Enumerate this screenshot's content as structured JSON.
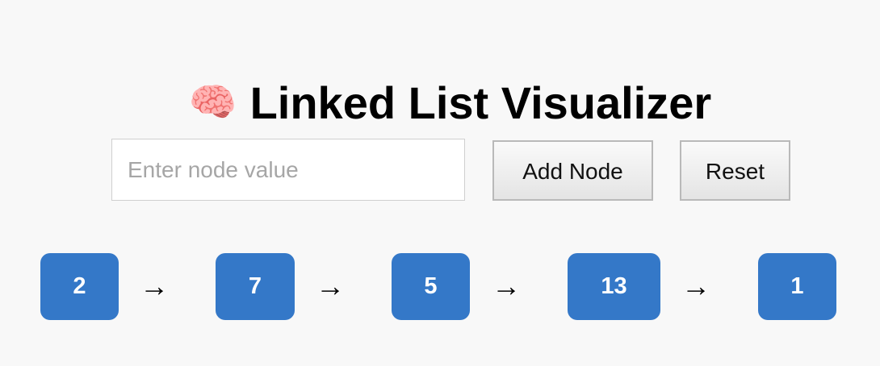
{
  "header": {
    "emoji": "🧠",
    "title": "Linked List Visualizer"
  },
  "controls": {
    "input_value": "",
    "input_placeholder": "Enter node value",
    "add_label": "Add Node",
    "reset_label": "Reset"
  },
  "list": {
    "nodes": [
      "2",
      "7",
      "5",
      "13",
      "1"
    ],
    "arrow": "→",
    "node_color": "#3478c8"
  }
}
